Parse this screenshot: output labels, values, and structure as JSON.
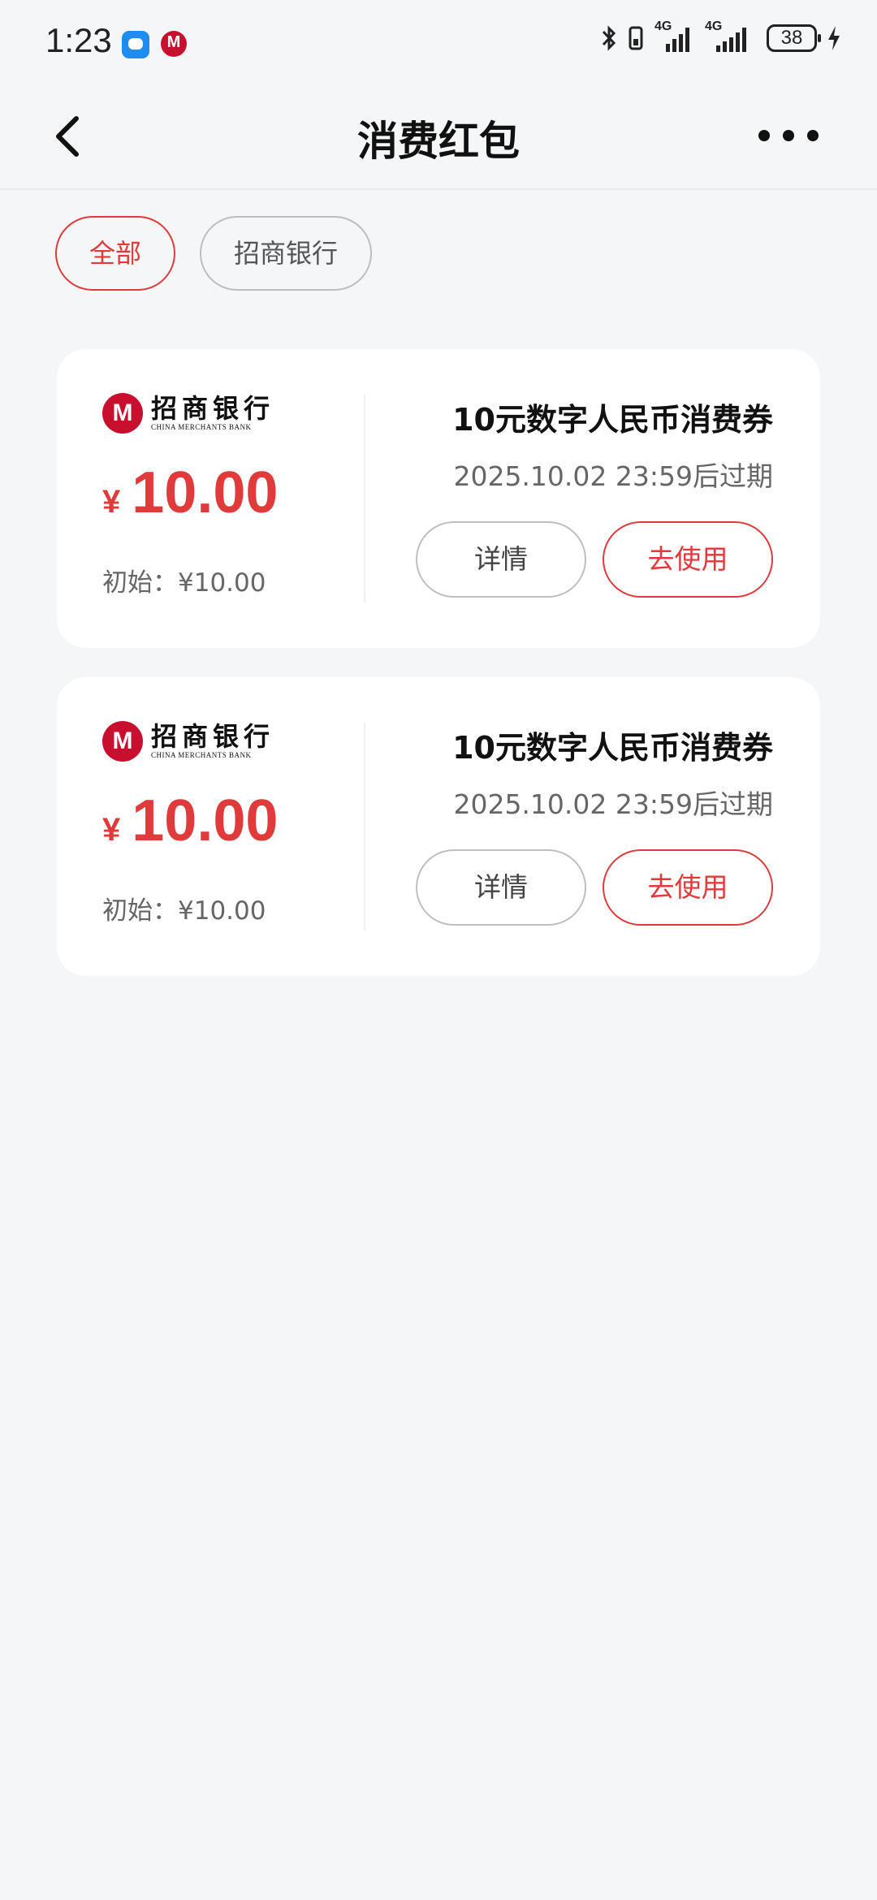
{
  "status_bar": {
    "time": "1:23",
    "network_1": "4G",
    "network_2": "4G",
    "battery": "38"
  },
  "header": {
    "title": "消费红包"
  },
  "filters": [
    {
      "label": "全部",
      "active": true
    },
    {
      "label": "招商银行",
      "active": false
    }
  ],
  "coupons": [
    {
      "bank_name": "招商银行",
      "bank_name_en": "CHINA MERCHANTS BANK",
      "currency": "¥",
      "amount": "10.00",
      "initial": "初始：¥10.00",
      "title": "10元数字人民币消费券",
      "expiry": "2025.10.02 23:59后过期",
      "detail_label": "详情",
      "use_label": "去使用"
    },
    {
      "bank_name": "招商银行",
      "bank_name_en": "CHINA MERCHANTS BANK",
      "currency": "¥",
      "amount": "10.00",
      "initial": "初始：¥10.00",
      "title": "10元数字人民币消费券",
      "expiry": "2025.10.02 23:59后过期",
      "detail_label": "详情",
      "use_label": "去使用"
    }
  ],
  "colors": {
    "accent": "#e03a3a",
    "bank_red": "#c8102e",
    "background": "#f5f6f8"
  },
  "icons": {
    "back": "chevron-left-icon",
    "more": "more-horizontal-icon",
    "message": "message-app-icon",
    "bank_notif": "cmb-logo-icon",
    "bluetooth": "bluetooth-icon",
    "vibrate": "vibrate-icon",
    "signal": "signal-icon",
    "charging": "charging-bolt-icon"
  }
}
